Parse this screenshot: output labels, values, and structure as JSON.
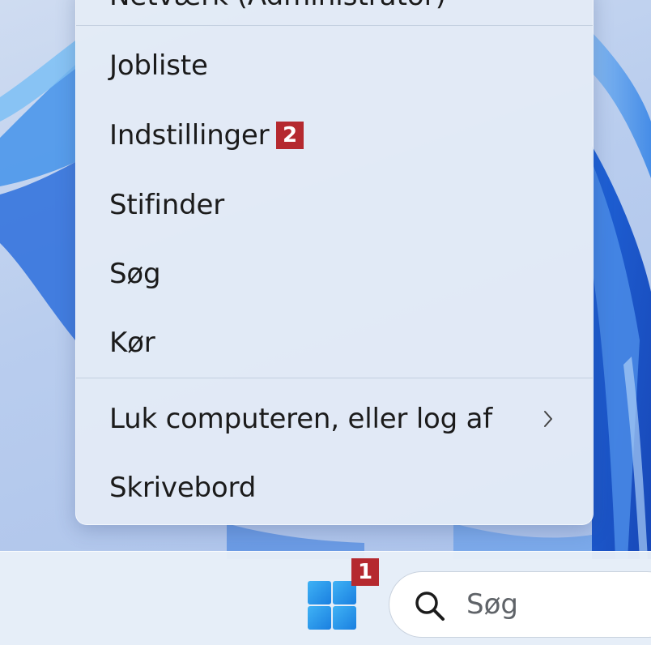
{
  "context_menu": {
    "cut_off_item": "Netværk (Administrator)",
    "items": [
      {
        "label": "Jobliste"
      },
      {
        "label": "Indstillinger"
      },
      {
        "label": "Stifinder"
      },
      {
        "label": "Søg"
      },
      {
        "label": "Kør"
      }
    ],
    "shutdown_item": {
      "label": "Luk computeren, eller log af",
      "icon": "chevron-right-icon"
    },
    "desktop_item": {
      "label": "Skrivebord"
    }
  },
  "annotations": {
    "start_badge": "1",
    "settings_badge": "2",
    "color": "#b5292f"
  },
  "taskbar": {
    "start_icon": "windows-logo-icon",
    "search": {
      "icon": "search-icon",
      "placeholder": "Søg"
    }
  }
}
